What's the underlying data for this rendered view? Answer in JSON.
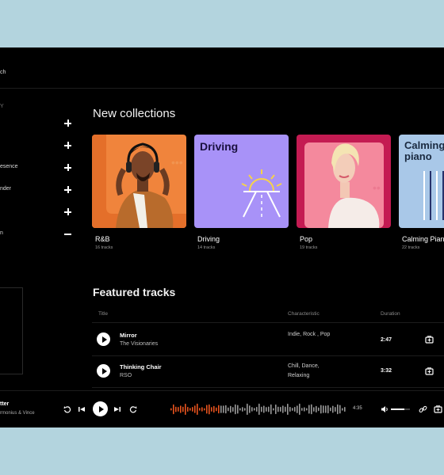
{
  "sidebar": {
    "search_text": "ch",
    "section_text": "Y",
    "items": [
      {
        "label": "",
        "toggle": "expand"
      },
      {
        "label": "",
        "toggle": "expand"
      },
      {
        "label": "esence",
        "toggle": "expand"
      },
      {
        "label": "nder",
        "toggle": "expand"
      },
      {
        "label": "",
        "toggle": "expand"
      },
      {
        "label": "n",
        "toggle": "collapse"
      }
    ]
  },
  "collections": {
    "title": "New collections",
    "cards": [
      {
        "name": "R&B",
        "count": "16 tracks",
        "cover_text": "",
        "bg": "#f0843c"
      },
      {
        "name": "Driving",
        "count": "14 tracks",
        "cover_text": "Driving",
        "bg": "#a892f8"
      },
      {
        "name": "Pop",
        "count": "19 tracks",
        "cover_text": "",
        "bg": "#c41b52"
      },
      {
        "name": "Calming Piano",
        "count": "22 tracks",
        "cover_text": "Calming piano",
        "bg": "#a9c8e8"
      }
    ]
  },
  "featured": {
    "title": "Featured tracks",
    "columns": {
      "title": "Title",
      "characteristic": "Characteristic",
      "duration": "Duration"
    },
    "tracks": [
      {
        "title": "Mirror",
        "artist": "The Visionaries",
        "characteristic": "Indie, Rock , Pop",
        "duration": "2:47"
      },
      {
        "title": "Thinking Chair",
        "artist": "RSO",
        "characteristic": "Chill, Dance, Relaxing",
        "duration": "3:32"
      }
    ]
  },
  "player": {
    "now_playing_title": "tter",
    "now_playing_artist": "rmonius & Vince",
    "time": "4:35",
    "progress": 0.28,
    "volume": 0.7
  },
  "colors": {
    "accent": "#e8541e",
    "background": "#000000",
    "outer": "#b3d4de"
  },
  "icons": [
    "plus-icon",
    "minus-icon",
    "play-icon",
    "replay-icon",
    "previous-icon",
    "next-icon",
    "repeat-icon",
    "volume-icon",
    "link-icon",
    "add-to-library-icon"
  ]
}
